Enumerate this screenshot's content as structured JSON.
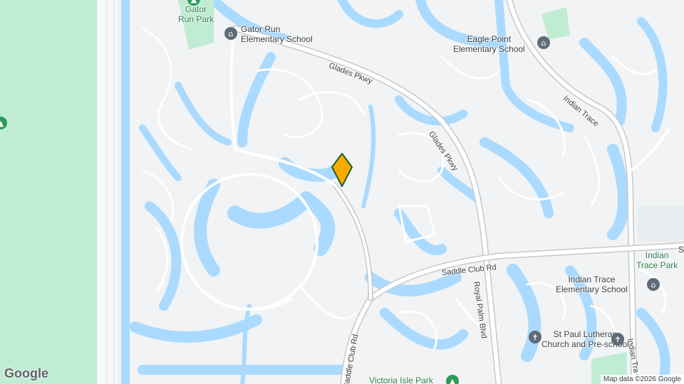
{
  "map": {
    "colors": {
      "water": "#aadaff",
      "land": "#f1f3f4",
      "park": "#c0ecd3",
      "road": "#ffffff",
      "marker": "#f9ab00"
    },
    "labels": {
      "gator_run_park": "Gator\nRun Park",
      "gator_run_school": "Gator Run\nElementary School",
      "eagle_point_school": "Eagle Point\nElementary School",
      "indian_trace_park": "Indian\nTrace Park",
      "indian_trace_school": "Indian Trace\nElementary School",
      "st_paul": "St Paul Lutheran\nChurch and Pre-school",
      "victoria_isle_park": "Victoria Isle Park",
      "s_partial": "S"
    },
    "roads": {
      "glades_pkwy_1": "Glades Pkwy",
      "glades_pkwy_2": "Glades Pkwy",
      "indian_trace_1": "Indian Trace",
      "indian_trace_2": "Indian Tra",
      "saddle_club_rd_1": "Saddle Club Rd",
      "saddle_club_rd_2": "Saddle Club Rd",
      "royal_palm_blvd": "Royal Palm Blvd"
    },
    "icons": [
      "school-icon",
      "park-icon",
      "church-icon",
      "location-pin-icon"
    ],
    "google_logo": "Google",
    "attribution": "Map data ©2026 Google"
  }
}
